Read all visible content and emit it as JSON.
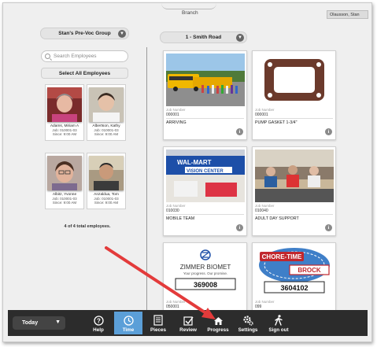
{
  "header": {
    "branch_label": "Branch",
    "user": "Olausson, Stan"
  },
  "group_select": {
    "value": "Stan's Pre-Voc Group"
  },
  "location_select": {
    "value": "1 - Smith Road"
  },
  "search": {
    "placeholder": "Search Employees"
  },
  "select_all_label": "Select All Employees",
  "employees": [
    {
      "name": "Adams, Miriam A",
      "job": "Job: 010001-03",
      "since": "Since: 9:00 AM"
    },
    {
      "name": "Albertson, Kathy",
      "job": "Job: 010001-03",
      "since": "Since: 9:00 AM"
    },
    {
      "name": "Albitz, Yvonne",
      "job": "Job: 010001-03",
      "since": "Since: 9:00 AM"
    },
    {
      "name": "Anzaldua, Tom",
      "job": "Job: 010001-03",
      "since": "Since: 9:00 AM"
    }
  ],
  "employee_total": "4 of 4 total employees.",
  "jobs": [
    {
      "label": "Job Number",
      "number": "000001",
      "desc": "ARRIVING"
    },
    {
      "label": "Job Number",
      "number": "000001",
      "desc": "PUMP GASKET 1-3/4\""
    },
    {
      "label": "Job Number",
      "number": "010030",
      "desc": "MOBILE TEAM"
    },
    {
      "label": "Job Number",
      "number": "010040",
      "desc": "ADULT DAY SUPPORT"
    },
    {
      "label": "Job Number",
      "number": "050001",
      "desc": "",
      "logo": "ZIMMER BIOMET",
      "logo_sub": "Your progress. Our promise.",
      "code": "369008"
    },
    {
      "label": "Job Number",
      "number": "099",
      "desc": "",
      "logo": "CHORE-TIME",
      "logo2": "BROCK",
      "code": "3604102"
    }
  ],
  "image_text": {
    "walmart": "WAL-MART",
    "vision": "VISION CENTER"
  },
  "toolbar": {
    "today": "Today",
    "help": "Help",
    "time": "Time",
    "pieces": "Pieces",
    "review": "Review",
    "progress": "Progress",
    "settings": "Settings",
    "signout": "Sign out"
  },
  "colors": {
    "toolbar_bg": "#2c2c2c",
    "active_tab": "#5b9fd8",
    "annotation_arrow": "#e33b3b"
  }
}
